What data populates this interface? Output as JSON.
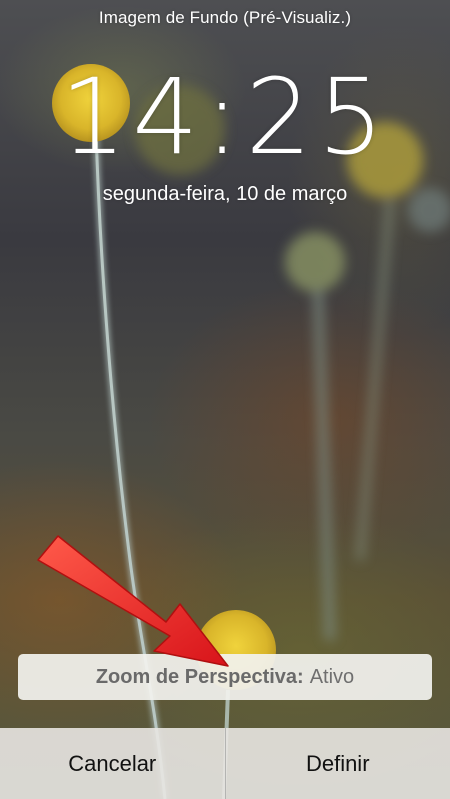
{
  "header": {
    "title": "Imagem de Fundo (Pré-Visualiz.)"
  },
  "lockscreen": {
    "time": "14:25",
    "date": "segunda-feira, 10 de março"
  },
  "perspective_zoom": {
    "label": "Zoom de Perspectiva:",
    "value": "Ativo"
  },
  "actions": {
    "cancel_label": "Cancelar",
    "set_label": "Definir"
  },
  "colors": {
    "arrow": "#e8201c",
    "flower": "#e2c131",
    "toolbar": "#e8e6e2"
  }
}
